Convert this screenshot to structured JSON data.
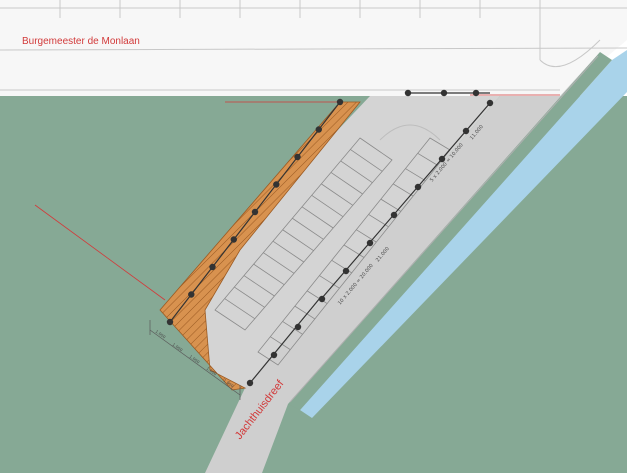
{
  "streets": {
    "north_name": "Burgemeester de Monlaan",
    "south_name": "Jachthuisdreef"
  },
  "dimension_labels": {
    "row_a_span": "11.000",
    "row_a_spacing": "5 x 2.000 = 10.000",
    "row_b_span": "21.000",
    "row_b_spacing": "10 x 2.000 = 20.000",
    "west_edge": "1.000"
  },
  "colors": {
    "grass": "#86a995",
    "road": "#cfcfcf",
    "street_north": "#f7f7f7",
    "parking_surface": "#d4d4d4",
    "planting_strip": "#d8924f",
    "water": "#a9d3ea",
    "bollard": "#333333",
    "street_label": "#d23a3a"
  },
  "icons": {
    "bollard": "black-dot-icon",
    "hatch": "diagonal-hatch-pattern"
  }
}
